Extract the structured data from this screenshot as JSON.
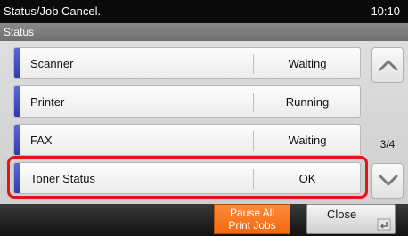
{
  "header": {
    "title": "Status/Job Cancel.",
    "time": "10:10"
  },
  "subheader": {
    "label": "Status"
  },
  "rows": [
    {
      "label": "Scanner",
      "status": "Waiting"
    },
    {
      "label": "Printer",
      "status": "Running"
    },
    {
      "label": "FAX",
      "status": "Waiting"
    },
    {
      "label": "Toner Status",
      "status": "OK"
    }
  ],
  "scroll": {
    "page_indicator": "3/4",
    "up_icon": "chevron-up-icon",
    "down_icon": "chevron-down-icon"
  },
  "buttons": {
    "pause_line1": "Pause All",
    "pause_line2": "Print Jobs",
    "close": "Close"
  },
  "colors": {
    "accent_blue": "#3a48c4",
    "highlight_red": "#e01515",
    "pause_orange": "#f27a22"
  }
}
